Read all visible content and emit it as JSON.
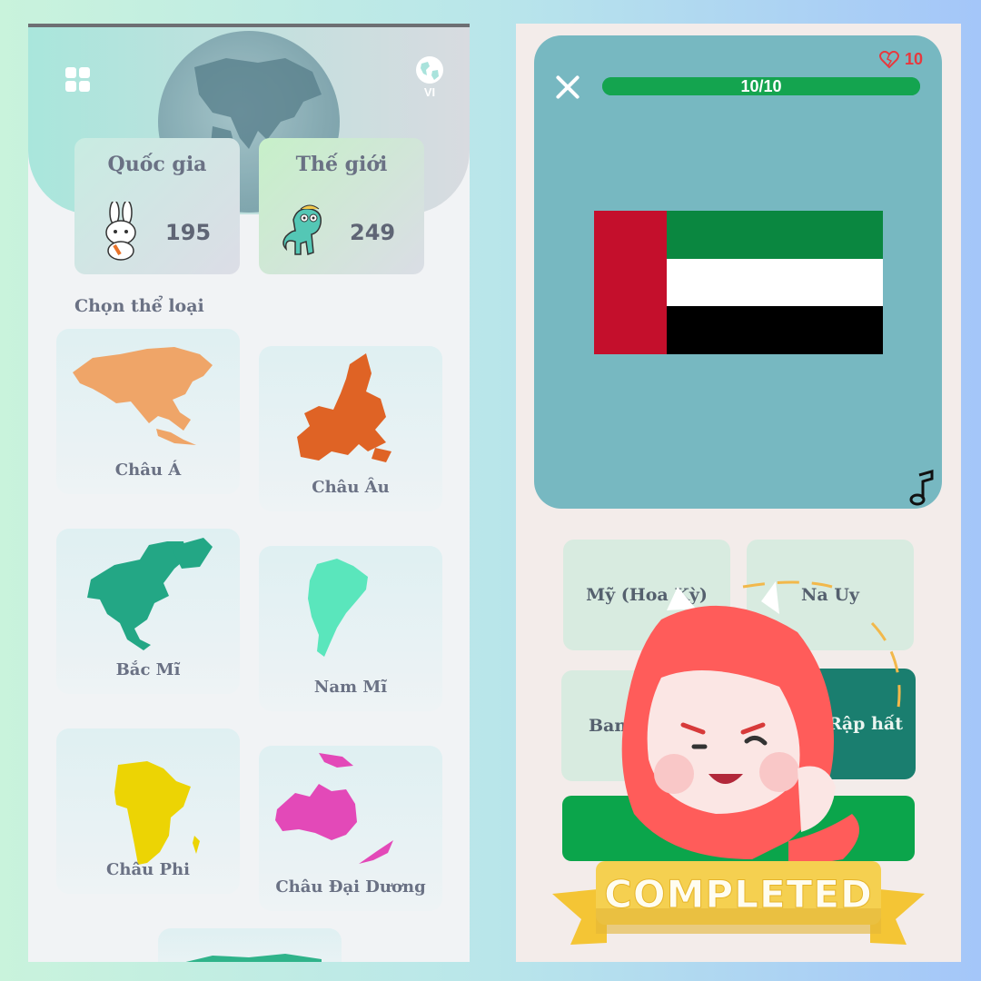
{
  "left": {
    "lang_label": "VI",
    "stats": [
      {
        "title": "Quốc gia",
        "count": "195"
      },
      {
        "title": "Thế giới",
        "count": "249"
      }
    ],
    "section_label": "Chọn thể loại",
    "categories": [
      {
        "label": "Châu Á",
        "color": "#efa568"
      },
      {
        "label": "Châu Âu",
        "color": "#df6325"
      },
      {
        "label": "Bắc Mĩ",
        "color": "#23a785"
      },
      {
        "label": "Nam Mĩ",
        "color": "#5ae6bc"
      },
      {
        "label": "Châu Phi",
        "color": "#ecd404"
      },
      {
        "label": "Châu Đại Dương",
        "color": "#e349b8"
      }
    ]
  },
  "right": {
    "lives": "10",
    "progress_text": "10/10",
    "progress_fraction": 1.0,
    "flag_colors": {
      "red": "#c40f2c",
      "green": "#0a8740",
      "white": "#ffffff",
      "black": "#000000"
    },
    "answers": [
      {
        "label": "Mỹ (Hoa Kỳ)"
      },
      {
        "label": "Na Uy"
      },
      {
        "label": "Ban"
      },
      {
        "label": "vương Rập hất"
      }
    ],
    "submit_label": "T",
    "completed_label": "COMPLETED"
  }
}
